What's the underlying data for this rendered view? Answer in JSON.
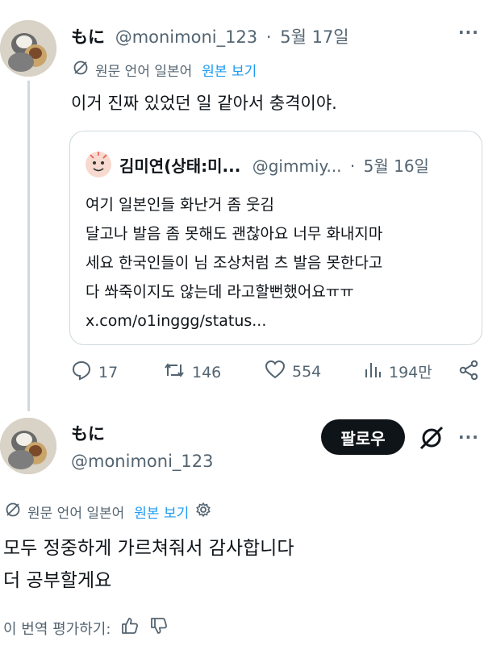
{
  "tweet1": {
    "display_name": "もに",
    "handle": "@monimoni_123",
    "sep": "·",
    "date": "5월 17일",
    "more": "···",
    "translate_prefix": "원문 언어 일본어",
    "translate_link": "원본 보기",
    "text": "이거 진짜 있었던 일 같아서 충격이야.",
    "quote": {
      "display_name": "김미연(상태:미...",
      "handle": "@gimmiy...",
      "sep": "·",
      "date": "5월 16일",
      "lines": [
        "여기 일본인들 화난거 좀 웃김",
        "달고나 발음 좀 못해도 괜찮아요 너무 화내지마",
        "세요 한국인들이 님 조상처럼 츠 발음 못한다고",
        "다 쏴죽이지도 않는데 라고할뻔했어요ㅠㅠ",
        "x.com/o1inggg/status..."
      ]
    },
    "actions": {
      "replies": "17",
      "retweets": "146",
      "likes": "554",
      "views": "194만"
    }
  },
  "tweet2": {
    "display_name": "もに",
    "handle": "@monimoni_123",
    "follow_label": "팔로우",
    "more": "···",
    "translate_prefix": "원문 언어 일본어",
    "translate_link": "원본 보기",
    "lines": [
      "모두 정중하게 가르쳐줘서 감사합니다",
      "더 공부할게요"
    ],
    "rate_label": "이 번역 평가하기:"
  },
  "colors": {
    "accent": "#1d9bf0",
    "muted": "#536471",
    "text": "#0f1419",
    "border": "#cfd9de"
  }
}
